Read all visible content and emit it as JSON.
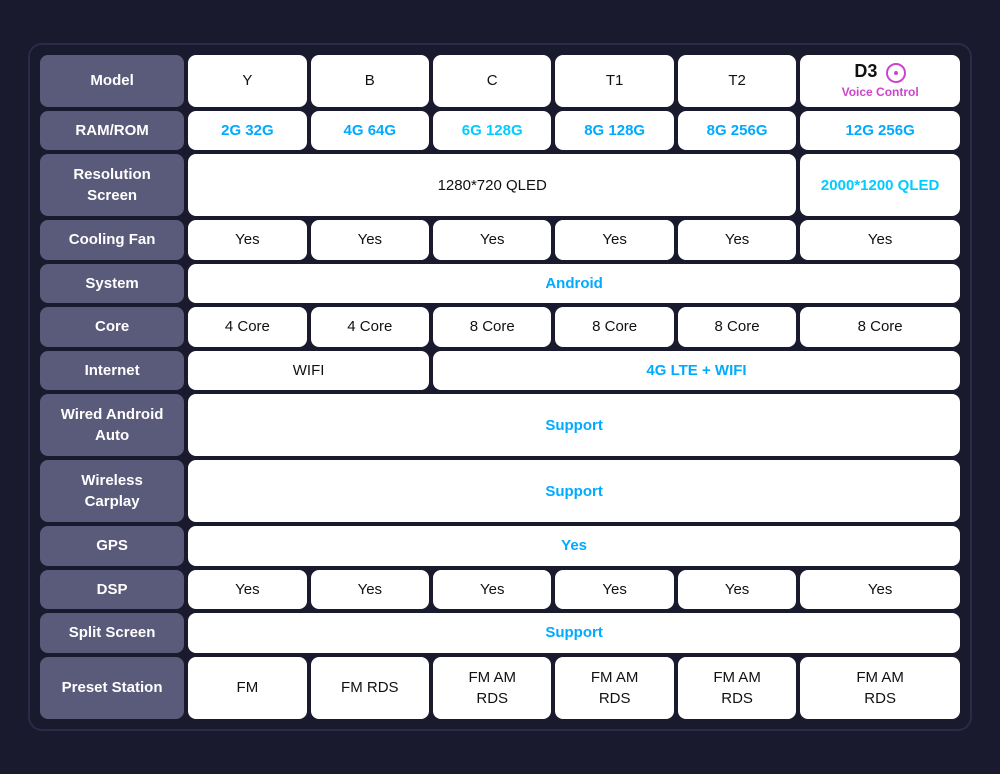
{
  "headers": {
    "row_label": "Model",
    "columns": [
      "Y",
      "B",
      "C",
      "T1",
      "T2",
      "D3"
    ]
  },
  "rows": [
    {
      "label": "RAM/ROM",
      "cells": [
        {
          "text": "2G 32G",
          "style": "blue"
        },
        {
          "text": "4G 64G",
          "style": "blue"
        },
        {
          "text": "6G 128G",
          "style": "cyan"
        },
        {
          "text": "8G 128G",
          "style": "blue"
        },
        {
          "text": "8G 256G",
          "style": "blue"
        },
        {
          "text": "12G 256G",
          "style": "blue"
        }
      ]
    },
    {
      "label": "Resolution\nScreen",
      "cells": [
        {
          "text": "1280*720 QLED",
          "style": "normal",
          "colspan": 5
        },
        {
          "text": "2000*1200 QLED",
          "style": "cyan"
        }
      ]
    },
    {
      "label": "Cooling Fan",
      "cells": [
        {
          "text": "Yes",
          "style": "normal"
        },
        {
          "text": "Yes",
          "style": "normal"
        },
        {
          "text": "Yes",
          "style": "normal"
        },
        {
          "text": "Yes",
          "style": "normal"
        },
        {
          "text": "Yes",
          "style": "normal"
        },
        {
          "text": "Yes",
          "style": "normal"
        }
      ]
    },
    {
      "label": "System",
      "cells": [
        {
          "text": "Android",
          "style": "blue",
          "colspan": 6
        }
      ]
    },
    {
      "label": "Core",
      "cells": [
        {
          "text": "4 Core",
          "style": "normal"
        },
        {
          "text": "4 Core",
          "style": "normal"
        },
        {
          "text": "8 Core",
          "style": "normal"
        },
        {
          "text": "8 Core",
          "style": "normal"
        },
        {
          "text": "8 Core",
          "style": "normal"
        },
        {
          "text": "8 Core",
          "style": "normal"
        }
      ]
    },
    {
      "label": "Internet",
      "cells": [
        {
          "text": "WIFI",
          "style": "normal",
          "colspan": 2
        },
        {
          "text": "4G LTE + WIFI",
          "style": "blue",
          "colspan": 4
        }
      ]
    },
    {
      "label": "Wired Android\nAuto",
      "cells": [
        {
          "text": "Support",
          "style": "blue",
          "colspan": 6
        }
      ]
    },
    {
      "label": "Wireless\nCarplay",
      "cells": [
        {
          "text": "Support",
          "style": "blue",
          "colspan": 6
        }
      ]
    },
    {
      "label": "GPS",
      "cells": [
        {
          "text": "Yes",
          "style": "blue",
          "colspan": 6
        }
      ]
    },
    {
      "label": "DSP",
      "cells": [
        {
          "text": "Yes",
          "style": "normal"
        },
        {
          "text": "Yes",
          "style": "normal"
        },
        {
          "text": "Yes",
          "style": "normal"
        },
        {
          "text": "Yes",
          "style": "normal"
        },
        {
          "text": "Yes",
          "style": "normal"
        },
        {
          "text": "Yes",
          "style": "normal"
        }
      ]
    },
    {
      "label": "Split Screen",
      "cells": [
        {
          "text": "Support",
          "style": "blue",
          "colspan": 6
        }
      ]
    },
    {
      "label": "Preset Station",
      "cells": [
        {
          "text": "FM",
          "style": "normal"
        },
        {
          "text": "FM RDS",
          "style": "normal"
        },
        {
          "text": "FM AM\nRDS",
          "style": "normal"
        },
        {
          "text": "FM AM\nRDS",
          "style": "normal"
        },
        {
          "text": "FM AM\nRDS",
          "style": "normal"
        },
        {
          "text": "FM AM\nRDS",
          "style": "normal"
        }
      ]
    }
  ],
  "d3_label": "D3",
  "d3_subtitle": "Voice Control"
}
